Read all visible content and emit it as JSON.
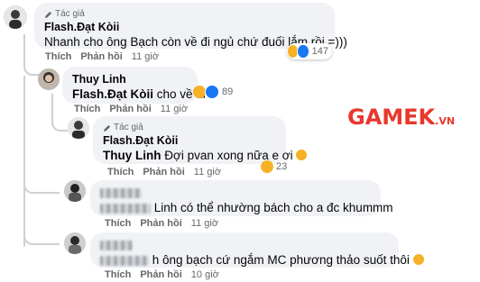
{
  "comments": [
    {
      "author_badge": "Tác giả",
      "name": "Flash.Đạt Kòii",
      "text": "Nhanh cho ông Bạch còn về đi ngủ chứ đuối lắm rồi =)))",
      "reaction_count": "147",
      "like_label": "Thích",
      "reply_label": "Phản hồi",
      "time": "11 giờ"
    },
    {
      "name": "Thuy Linh",
      "mention": "Flash.Đạt Kòii",
      "text": " cho về đi",
      "reaction_count": "89",
      "like_label": "Thích",
      "reply_label": "Phản hồi",
      "time": "11 giờ"
    },
    {
      "author_badge": "Tác giả",
      "name": "Flash.Đạt Kòii",
      "mention": "Thuy Linh",
      "text": " Đợi pvan xong nữa e ơi",
      "reaction_count": "23",
      "like_label": "Thích",
      "reply_label": "Phản hồi",
      "time": "11 giờ"
    },
    {
      "text": "Linh có thể nhường bách cho a đc khummm",
      "like_label": "Thích",
      "reply_label": "Phản hồi",
      "time": "11 giờ"
    },
    {
      "text": "h ông bạch cứ ngắm MC phương thảo suốt thôi",
      "like_label": "Thích",
      "reply_label": "Phản hồi",
      "time": "10 giờ"
    }
  ],
  "watermark": {
    "brand": "GAMEK",
    "suffix": ".VN"
  },
  "colors": {
    "bubble": "#f0f2f5",
    "meta": "#65676b",
    "brand": "#e8382d",
    "like": "#1877f2",
    "haha": "#f7b125"
  },
  "icons": [
    "pen-icon",
    "haha-emoji-icon",
    "like-icon",
    "laugh-tears-emoji-icon"
  ]
}
